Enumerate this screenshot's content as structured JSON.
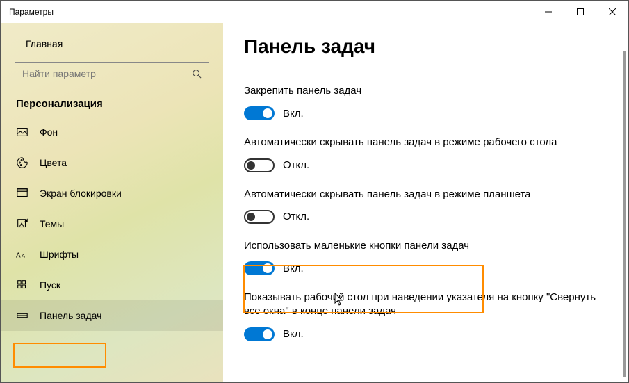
{
  "window": {
    "title": "Параметры"
  },
  "sidebar": {
    "home": "Главная",
    "search_placeholder": "Найти параметр",
    "category": "Персонализация",
    "items": [
      {
        "label": "Фон"
      },
      {
        "label": "Цвета"
      },
      {
        "label": "Экран блокировки"
      },
      {
        "label": "Темы"
      },
      {
        "label": "Шрифты"
      },
      {
        "label": "Пуск"
      },
      {
        "label": "Панель задач"
      }
    ]
  },
  "main": {
    "title": "Панель задач",
    "settings": [
      {
        "label": "Закрепить панель задач",
        "state": "Вкл.",
        "on": true
      },
      {
        "label": "Автоматически скрывать панель задач в режиме рабочего стола",
        "state": "Откл.",
        "on": false
      },
      {
        "label": "Автоматически скрывать панель задач в режиме планшета",
        "state": "Откл.",
        "on": false
      },
      {
        "label": "Использовать маленькие кнопки панели задач",
        "state": "Вкл.",
        "on": true
      },
      {
        "label": "Показывать рабочий стол при наведении указателя на кнопку \"Свернуть все окна\" в конце панели задач",
        "state": "Вкл.",
        "on": true
      }
    ]
  }
}
